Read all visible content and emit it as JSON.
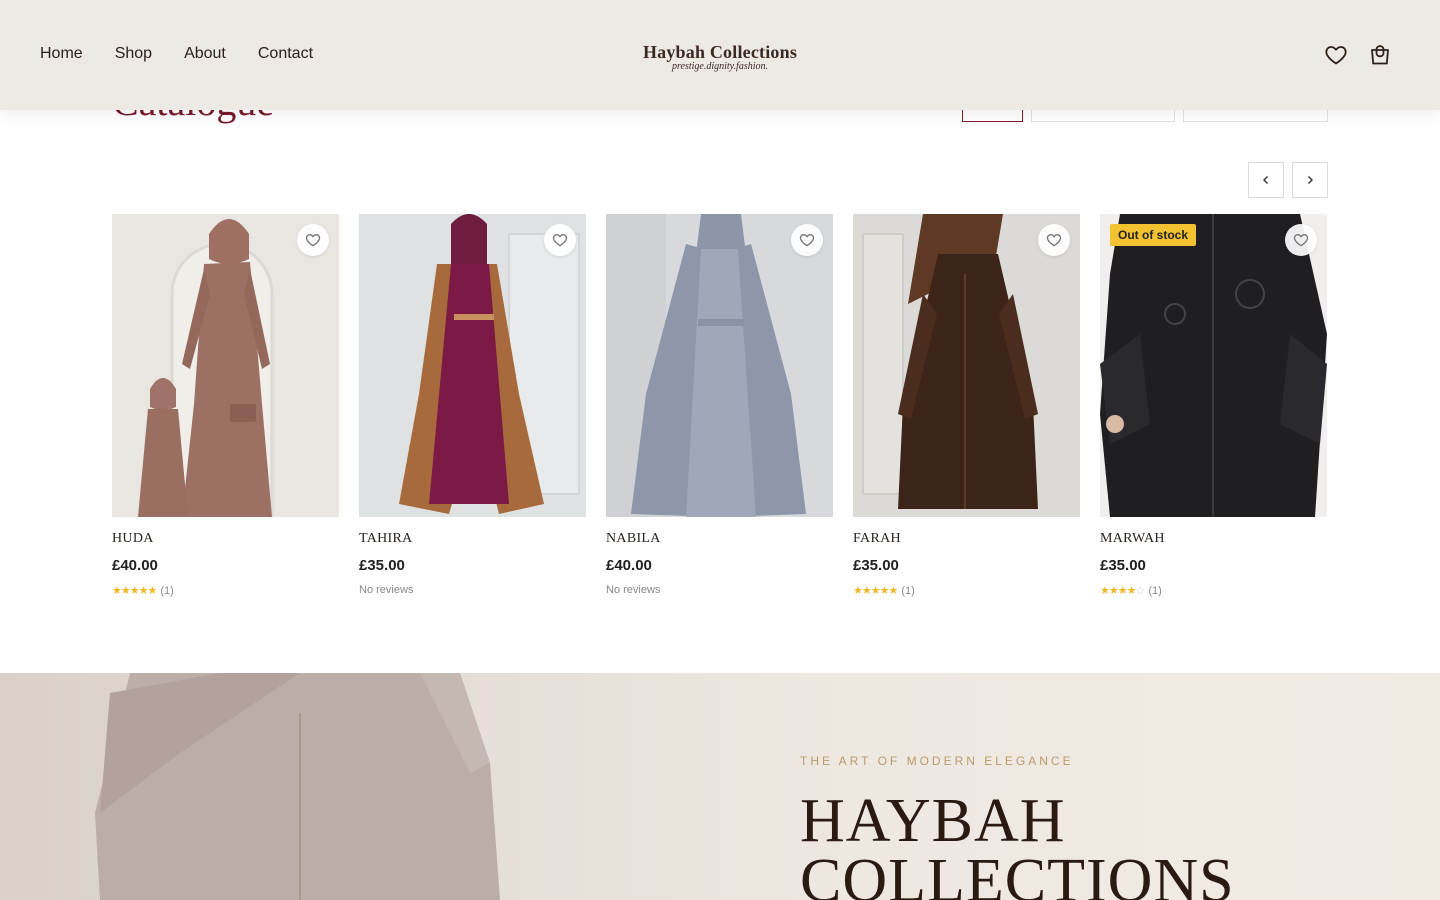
{
  "header": {
    "nav": [
      "Home",
      "Shop",
      "About",
      "Contact"
    ],
    "logo_title": "Haybah Collections",
    "logo_tagline": "prestige.dignity.fashion.",
    "icons": [
      "heart-icon",
      "shopping-bag-icon"
    ]
  },
  "catalogue": {
    "title": "Catalogue",
    "slider": {
      "prev_icon": "chevron-left-icon",
      "next_icon": "chevron-right-icon"
    }
  },
  "products": [
    {
      "name": "HUDA",
      "price": "£40.00",
      "rating": 5,
      "reviews": "(1)",
      "badge": null
    },
    {
      "name": "TAHIRA",
      "price": "£35.00",
      "rating": 0,
      "reviews": "No reviews",
      "badge": null
    },
    {
      "name": "NABILA",
      "price": "£40.00",
      "rating": 0,
      "reviews": "No reviews",
      "badge": null
    },
    {
      "name": "FARAH",
      "price": "£35.00",
      "rating": 5,
      "reviews": "(1)",
      "badge": null
    },
    {
      "name": "MARWAH",
      "price": "£35.00",
      "rating": 4,
      "reviews": "(1)",
      "badge": "Out of stock"
    }
  ],
  "hero": {
    "kicker": "THE ART OF MODERN ELEGANCE",
    "title_line1": "HAYBAH",
    "title_line2": "COLLECTIONS"
  },
  "colors": {
    "header_bg": "#ede9e4",
    "accent_maroon": "#7a1a2a",
    "badge_yellow": "#f2c230",
    "star_gold": "#f2b824",
    "hero_kicker_gold": "#b89b6e"
  }
}
